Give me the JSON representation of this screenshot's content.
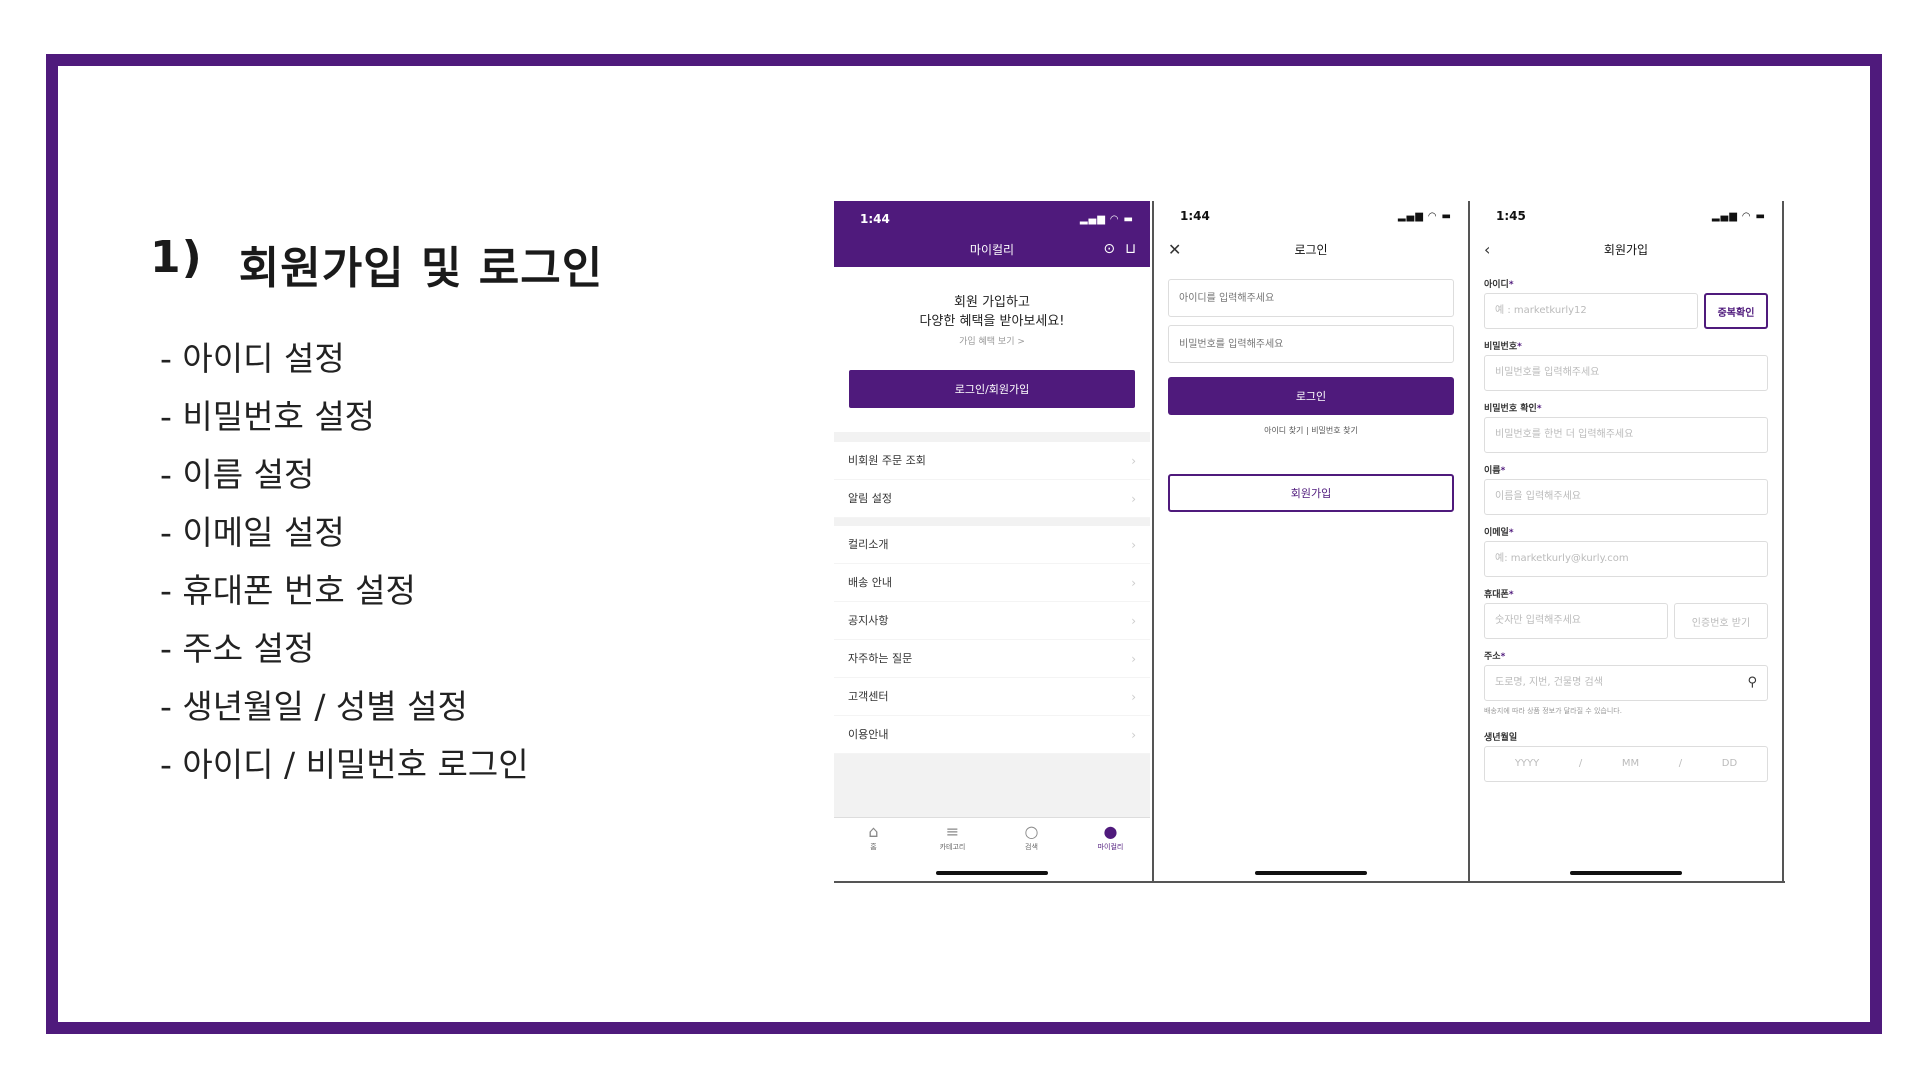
{
  "slide": {
    "number": "1)",
    "title": "회원가입 및 로그인",
    "items": [
      "- 아이디 설정",
      "- 비밀번호 설정",
      "- 이름 설정",
      "- 이메일 설정",
      "- 휴대폰 번호 설정",
      "- 주소 설정",
      "- 생년월일 / 성별 설정",
      "- 아이디 / 비밀번호 로그인"
    ]
  },
  "colors": {
    "brand": "#4f1a7c"
  },
  "phone1": {
    "time": "1:44",
    "title": "마이컬리",
    "promo_line1": "회원 가입하고",
    "promo_line2": "다양한 혜택을 받아보세요!",
    "promo_link": "가입 혜택 보기 >",
    "login_button": "로그인/회원가입",
    "menu1": [
      "비회원 주문 조회",
      "알림 설정"
    ],
    "menu2": [
      "컬리소개",
      "배송 안내",
      "공지사항",
      "자주하는 질문",
      "고객센터",
      "이용안내"
    ],
    "tabs": [
      "홈",
      "카테고리",
      "검색",
      "마이컬리"
    ]
  },
  "phone2": {
    "time": "1:44",
    "title": "로그인",
    "id_placeholder": "아이디를 입력해주세요",
    "pw_placeholder": "비밀번호를 입력해주세요",
    "login_button": "로그인",
    "find_links": "아이디 찾기 | 비밀번호 찾기",
    "signup_button": "회원가입"
  },
  "phone3": {
    "time": "1:45",
    "title": "회원가입",
    "id_label": "아이디",
    "id_placeholder": "예 : marketkurly12",
    "dup_button": "중복확인",
    "pw_label": "비밀번호",
    "pw_placeholder": "비밀번호를 입력해주세요",
    "pwc_label": "비밀번호 확인",
    "pwc_placeholder": "비밀번호를 한번 더 입력해주세요",
    "name_label": "이름",
    "name_placeholder": "이름을 입력해주세요",
    "email_label": "이메일",
    "email_placeholder": "예: marketkurly@kurly.com",
    "phone_label": "휴대폰",
    "phone_placeholder": "숫자만 입력해주세요",
    "cert_button": "인증번호 받기",
    "addr_label": "주소",
    "addr_placeholder": "도로명, 지번, 건물명 검색",
    "addr_note": "배송지에 따라 상품 정보가 달라질 수 있습니다.",
    "birth_label": "생년월일",
    "birth_y": "YYYY",
    "birth_sep": "/",
    "birth_m": "MM",
    "birth_d": "DD"
  }
}
